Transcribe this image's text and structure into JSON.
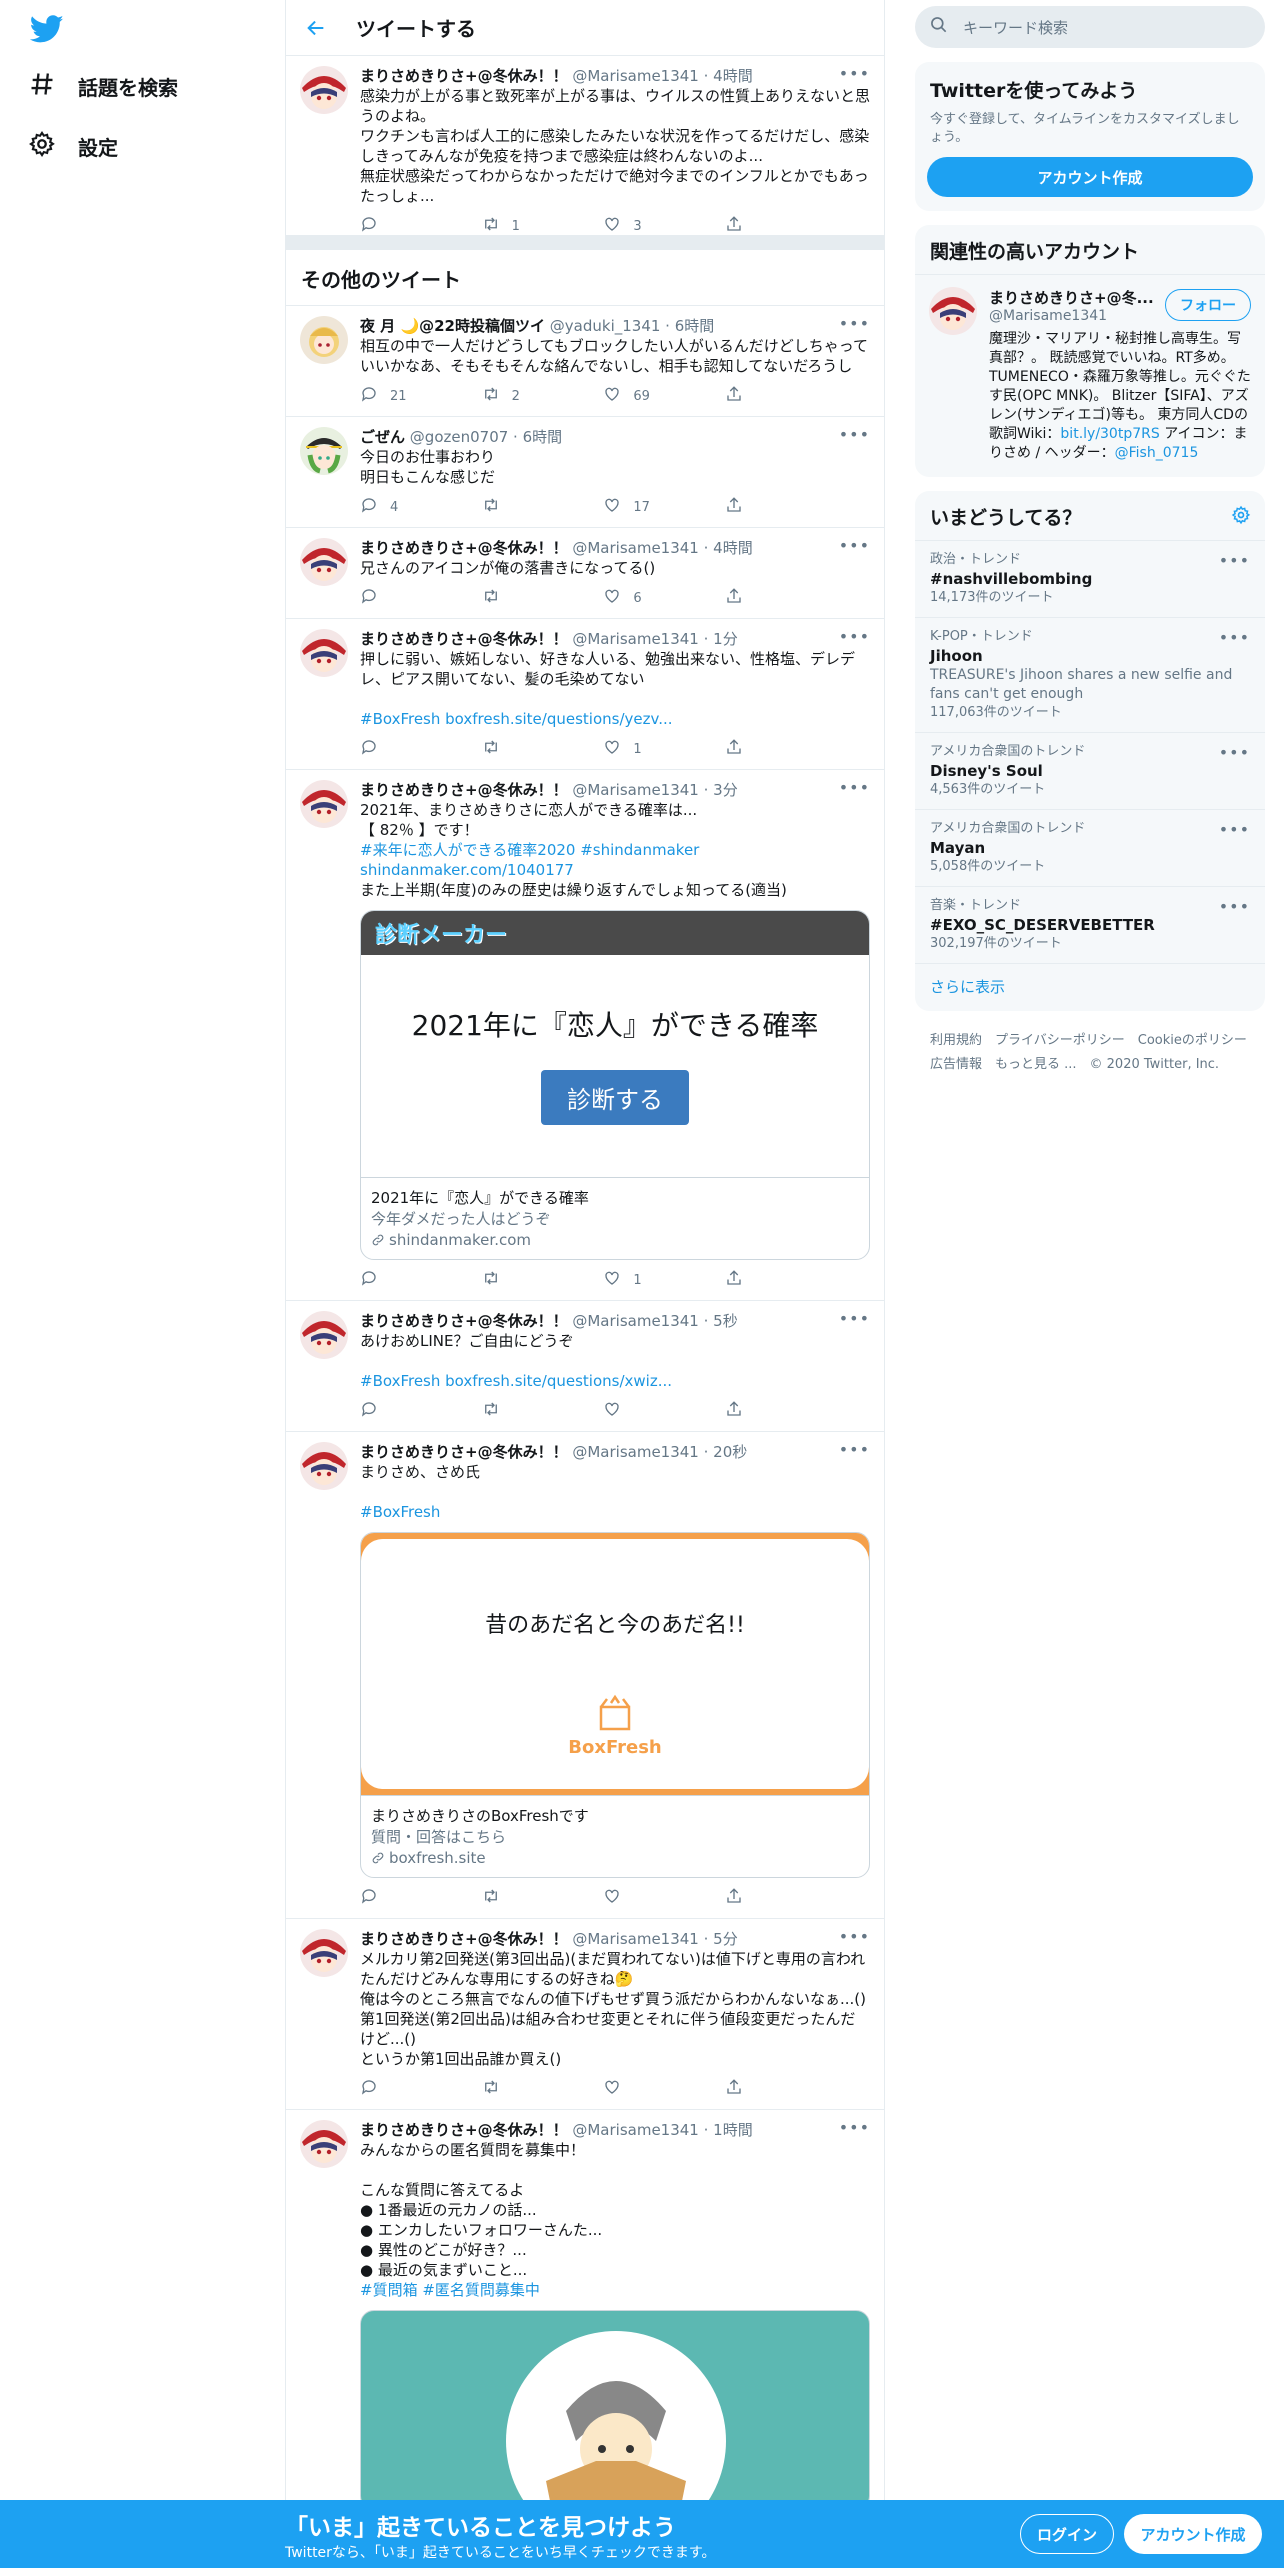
{
  "nav": {
    "explore": "話題を検索",
    "settings": "設定"
  },
  "header": {
    "title": "ツイートする"
  },
  "main_tweet": {
    "name": "まりさめきりさ+@冬休み！！",
    "handle": "@Marisame1341",
    "time": "4時間",
    "text": "感染力が上がる事と致死率が上がる事は、ウイルスの性質上ありえないと思うのよね。\nワクチンも言わば人工的に感染したみたいな状況を作ってるだけだし、感染しきってみんなが免疫を持つまで感染症は終わんないのよ...\n無症状感染だってわからなかっただけで絶対今までのインフルとかでもあったっしょ...",
    "replies": "",
    "retweets": "1",
    "likes": "3"
  },
  "section_title": "その他のツイート",
  "tweets": [
    {
      "name": "夜 月 🌙@22時投稿個ツイ",
      "handle": "@yaduki_1341",
      "time": "6時間",
      "text": "相互の中で一人だけどうしてもブロックしたい人がいるんだけどしちゃっていいかなあ、そもそもそんな絡んでないし、相手も認知してないだろうし",
      "replies": "21",
      "retweets": "2",
      "likes": "69"
    },
    {
      "name": "ごぜん",
      "handle": "@gozen0707",
      "time": "6時間",
      "text": "今日のお仕事おわり\n明日もこんな感じだ",
      "replies": "4",
      "retweets": "",
      "likes": "17"
    },
    {
      "name": "まりさめきりさ+@冬休み！！",
      "handle": "@Marisame1341",
      "time": "4時間",
      "text": "兄さんのアイコンが俺の落書きになってる()",
      "replies": "",
      "retweets": "",
      "likes": "6"
    },
    {
      "name": "まりさめきりさ+@冬休み！！",
      "handle": "@Marisame1341",
      "time": "1分",
      "text": "押しに弱い、嫉妬しない、好きな人いる、勉強出来ない、性格塩、デレデレ、ピアス開いてない、髪の毛染めてない",
      "link": "#BoxFresh boxfresh.site/questions/yezv...",
      "replies": "",
      "retweets": "",
      "likes": "1"
    },
    {
      "name": "まりさめきりさ+@冬休み！！",
      "handle": "@Marisame1341",
      "time": "3分",
      "text1": "2021年、まりさめきりさに恋人ができる確率は...\n【 82％ 】です！",
      "link": "#来年に恋人ができる確率2020 #shindanmaker\nshindanmaker.com/1040177",
      "text2": "また上半期(年度)のみの歴史は繰り返すんでしょ知ってる(適当)",
      "card": {
        "brand": "診断メーカー",
        "headline": "2021年に『恋人』ができる確率",
        "button": "診断する",
        "title": "2021年に『恋人』ができる確率",
        "desc": "今年ダメだった人はどうぞ",
        "domain": "shindanmaker.com"
      },
      "replies": "",
      "retweets": "",
      "likes": "1"
    },
    {
      "name": "まりさめきりさ+@冬休み！！",
      "handle": "@Marisame1341",
      "time": "5秒",
      "text": "あけおめLINE？ご自由にどうぞ",
      "link": "#BoxFresh boxfresh.site/questions/xwiz...",
      "replies": "",
      "retweets": "",
      "likes": ""
    },
    {
      "name": "まりさめきりさ+@冬休み！！",
      "handle": "@Marisame1341",
      "time": "20秒",
      "text": "まりさめ、さめ氏",
      "link": "#BoxFresh",
      "card": {
        "headline": "昔のあだ名と今のあだ名!!",
        "brand": "BoxFresh",
        "title": "まりさめきりさのBoxFreshです",
        "desc": "質問・回答はこちら",
        "domain": "boxfresh.site"
      },
      "replies": "",
      "retweets": "",
      "likes": ""
    },
    {
      "name": "まりさめきりさ+@冬休み！！",
      "handle": "@Marisame1341",
      "time": "5分",
      "text": "メルカリ第2回発送(第3回出品)(まだ買われてない)は値下げと専用の言われたんだけどみんな専用にするの好きね🤔\n俺は今のところ無言でなんの値下げもせず買う派だからわかんないなぁ...()\n第1回発送(第2回出品)は組み合わせ変更とそれに伴う値段変更だったんだけど...()\nというか第1回出品誰か買え()",
      "replies": "",
      "retweets": "",
      "likes": ""
    },
    {
      "name": "まりさめきりさ+@冬休み！！",
      "handle": "@Marisame1341",
      "time": "1時間",
      "text": "みんなからの匿名質問を募集中！\n\nこんな質問に答えてるよ\n● 1番最近の元カノの話...\n● エンカしたいフォロワーさんた...\n● 異性のどこが好き？...\n● 最近の気まずいこと...",
      "link": "#質問箱 #匿名質問募集中"
    }
  ],
  "search": {
    "placeholder": "キーワード検索"
  },
  "signup": {
    "title": "Twitterを使ってみよう",
    "text": "今すぐ登録して、タイムラインをカスタマイズしましょう。",
    "button": "アカウント作成"
  },
  "relevant": {
    "title": "関連性の高いアカウント",
    "name": "まりさめきりさ+@冬...",
    "handle": "@Marisame1341",
    "follow": "フォロー",
    "bio": "魔理沙・マリアリ・秘封推し高専生。写真部？。 既読感覚でいいね。RT多め。 TUMENECO・森羅万象等推し。元ぐぐたす民(OPC MNK)。 Blitzer【SIFA】、アズレン(サンディエゴ)等も。 東方同人CDの歌詞Wiki：",
    "bio_link": "bit.ly/30tp7RS",
    "bio_tail": " アイコン：まりさめ / ヘッダー：",
    "bio_link2": "@Fish_0715"
  },
  "trends": {
    "title": "いまどうしてる？",
    "items": [
      {
        "cat": "政治・トレンド",
        "name": "#nashvillebombing",
        "desc": "",
        "count": "14,173件のツイート"
      },
      {
        "cat": "K-POP・トレンド",
        "name": "Jihoon",
        "desc": "TREASURE's Jihoon shares a new selfie and fans can't get enough",
        "count": "117,063件のツイート"
      },
      {
        "cat": "アメリカ合衆国のトレンド",
        "name": "Disney's Soul",
        "desc": "",
        "count": "4,563件のツイート"
      },
      {
        "cat": "アメリカ合衆国のトレンド",
        "name": "Mayan",
        "desc": "",
        "count": "5,058件のツイート"
      },
      {
        "cat": "音楽・トレンド",
        "name": "#EXO_SC_DESERVEBETTER",
        "desc": "",
        "count": "302,197件のツイート"
      }
    ],
    "more": "さらに表示"
  },
  "footer": {
    "line1": "利用規約　プライバシーポリシー　Cookieのポリシー",
    "line2": "広告情報　もっと見る ...　© 2020 Twitter, Inc."
  },
  "bottom": {
    "title": "「いま」起きていることを見つけよう",
    "sub": "Twitterなら、「いま」起きていることをいち早くチェックできます。",
    "login": "ログイン",
    "signup": "アカウント作成"
  },
  "colors": {
    "accent": "#1da1f2",
    "link": "#1b95e0",
    "muted": "#657786"
  }
}
